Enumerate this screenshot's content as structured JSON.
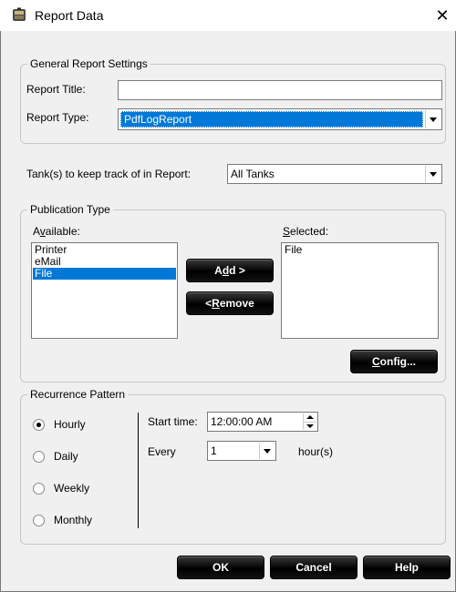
{
  "window": {
    "title": "Report Data",
    "close_label": "✕"
  },
  "general": {
    "legend": "General Report Settings",
    "report_title_label": "Report Title:",
    "report_title_value": "",
    "report_type_label": "Report Type:",
    "report_type_value": "PdfLogReport"
  },
  "tanks": {
    "label": "Tank(s) to keep track of in Report:",
    "value": "All Tanks"
  },
  "publication": {
    "legend": "Publication Type",
    "available_label_pre": "A",
    "available_label_ul": "v",
    "available_label_post": "ailable:",
    "available_items": [
      "Printer",
      "eMail",
      "File"
    ],
    "selected_label_pre": "",
    "selected_label_ul": "S",
    "selected_label_post": "elected:",
    "selected_items": [
      "File"
    ],
    "add_label_pre": "A",
    "add_label_ul": "d",
    "add_label_post": "d >",
    "remove_label_pre": "< ",
    "remove_label_ul": "R",
    "remove_label_post": "emove",
    "config_label_pre": "",
    "config_label_ul": "C",
    "config_label_post": "onfig..."
  },
  "recurrence": {
    "legend": "Recurrence Pattern",
    "options": [
      "Hourly",
      "Daily",
      "Weekly",
      "Monthly"
    ],
    "selected": "Hourly",
    "start_time_label": "Start time:",
    "start_time_value": "12:00:00 AM",
    "every_label": "Every",
    "every_value": "1",
    "unit_label": "hour(s)"
  },
  "footer": {
    "ok": "OK",
    "cancel": "Cancel",
    "help": "Help"
  }
}
